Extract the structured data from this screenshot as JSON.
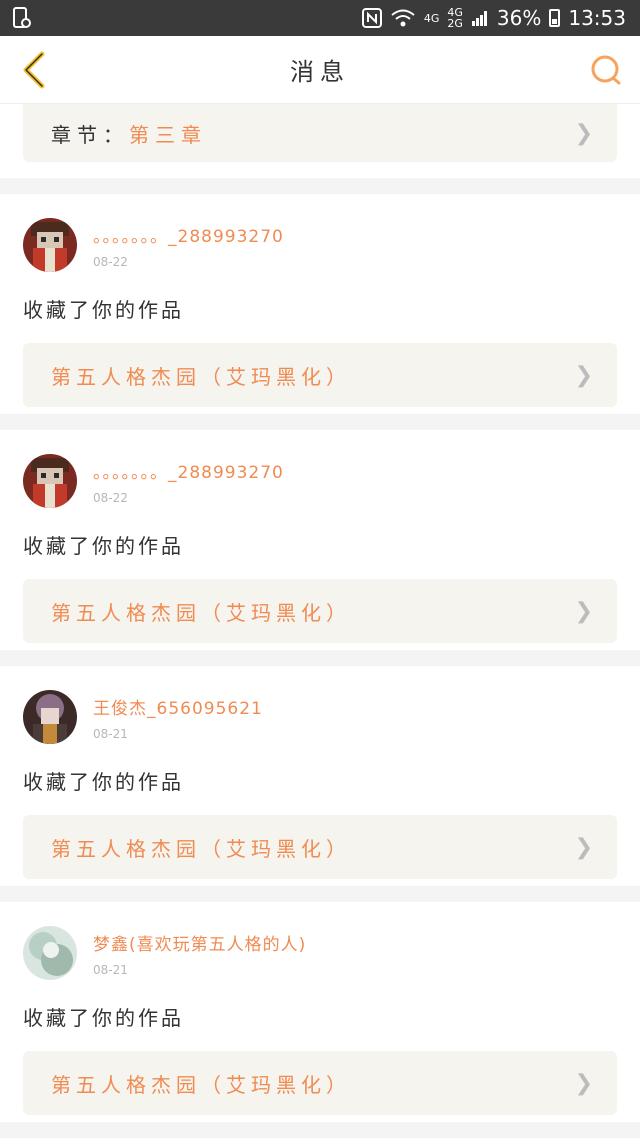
{
  "status": {
    "battery": "36%",
    "time": "13:53",
    "net1": "4G",
    "net2a": "4G",
    "net2b": "2G"
  },
  "header": {
    "title": "消息"
  },
  "chapter": {
    "label": "章节：",
    "value": "第三章"
  },
  "messages": [
    {
      "user": "。。。。。。。_288993270",
      "date": "08-22",
      "action": "收藏了你的作品",
      "work": "第五人格杰园（艾玛黑化）"
    },
    {
      "user": "。。。。。。。_288993270",
      "date": "08-22",
      "action": "收藏了你的作品",
      "work": "第五人格杰园（艾玛黑化）"
    },
    {
      "user": "王俊杰_656095621",
      "date": "08-21",
      "action": "收藏了你的作品",
      "work": "第五人格杰园（艾玛黑化）"
    },
    {
      "user": "梦鑫(喜欢玩第五人格的人)",
      "date": "08-21",
      "action": "收藏了你的作品",
      "work": "第五人格杰园（艾玛黑化）"
    }
  ]
}
